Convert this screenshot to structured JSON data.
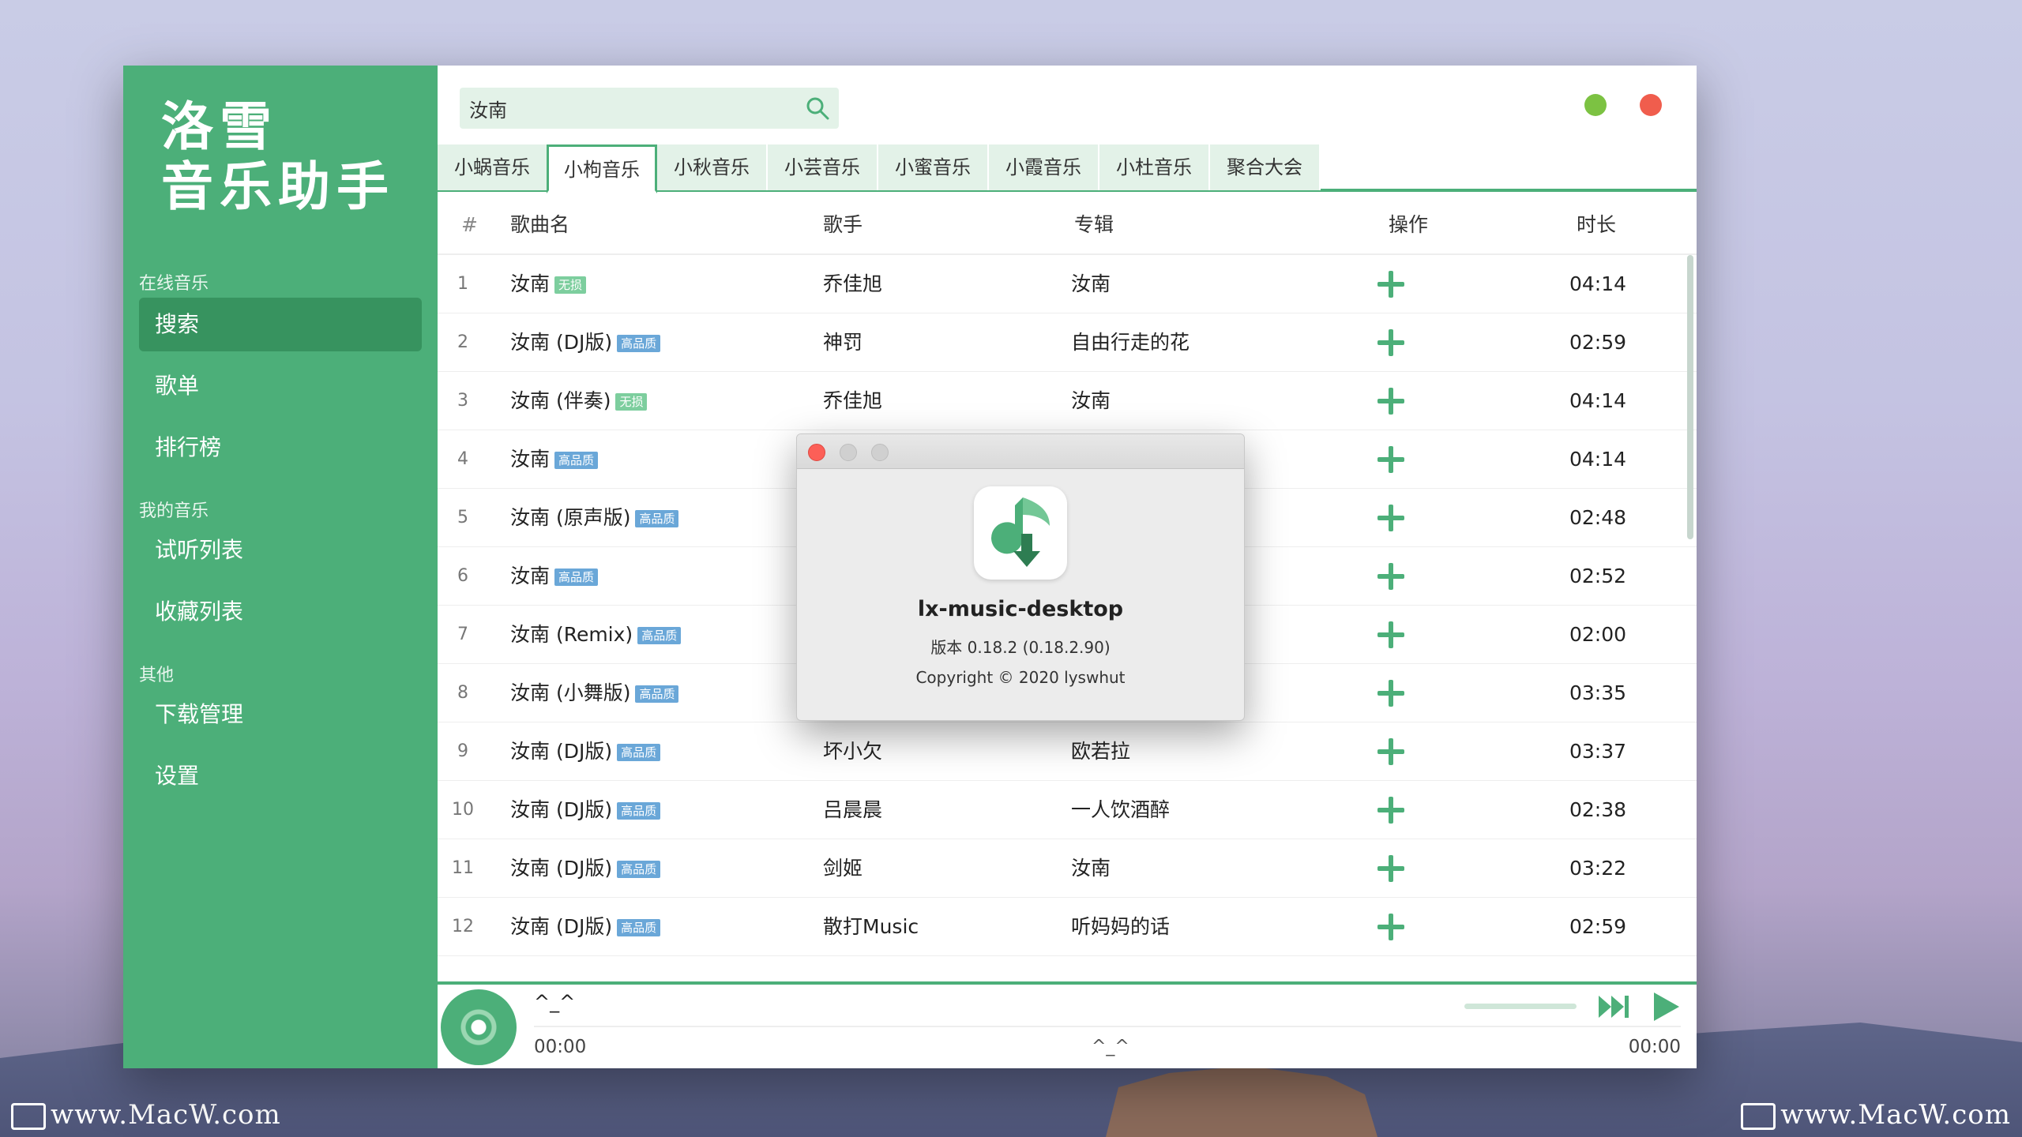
{
  "watermarks": [
    "www.MacW.com",
    "www.MacW.com"
  ],
  "sidebar": {
    "logo_line1": "洛雪",
    "logo_line2": "音乐助手",
    "groups": [
      "在线音乐",
      "我的音乐",
      "其他"
    ],
    "items": [
      "搜索",
      "歌单",
      "排行榜",
      "试听列表",
      "收藏列表",
      "下载管理",
      "设置"
    ]
  },
  "search": {
    "value": "汝南",
    "placeholder": ""
  },
  "tabs": [
    "小蜗音乐",
    "小枸音乐",
    "小秋音乐",
    "小芸音乐",
    "小蜜音乐",
    "小霞音乐",
    "小杜音乐",
    "聚合大会"
  ],
  "table": {
    "headers": [
      "#",
      "歌曲名",
      "歌手",
      "专辑",
      "操作",
      "时长"
    ],
    "rows": [
      {
        "n": "1",
        "title": "汝南",
        "badge": "无损",
        "singer": "乔佳旭",
        "album": "汝南",
        "time": "04:14"
      },
      {
        "n": "2",
        "title": "汝南 (DJ版)",
        "badge": "高品质",
        "singer": "神罚",
        "album": "自由行走的花",
        "time": "02:59"
      },
      {
        "n": "3",
        "title": "汝南 (伴奏)",
        "badge": "无损",
        "singer": "乔佳旭",
        "album": "汝南",
        "time": "04:14"
      },
      {
        "n": "4",
        "title": "汝南",
        "badge": "高品质",
        "singer": "",
        "album": "",
        "time": "04:14"
      },
      {
        "n": "5",
        "title": "汝南 (原声版)",
        "badge": "高品质",
        "singer": "",
        "album": "",
        "time": "02:48"
      },
      {
        "n": "6",
        "title": "汝南",
        "badge": "高品质",
        "singer": "",
        "album": "",
        "time": "02:52"
      },
      {
        "n": "7",
        "title": "汝南 (Remix)",
        "badge": "高品质",
        "singer": "",
        "album": "",
        "time": "02:00"
      },
      {
        "n": "8",
        "title": "汝南 (小舞版)",
        "badge": "高品质",
        "singer": "",
        "album": "",
        "time": "03:35"
      },
      {
        "n": "9",
        "title": "汝南 (DJ版)",
        "badge": "高品质",
        "singer": "坏小欠",
        "album": "欧若拉",
        "time": "03:37"
      },
      {
        "n": "10",
        "title": "汝南 (DJ版)",
        "badge": "高品质",
        "singer": "吕晨晨",
        "album": "一人饮酒醉",
        "time": "02:38"
      },
      {
        "n": "11",
        "title": "汝南 (DJ版)",
        "badge": "高品质",
        "singer": "剑姬",
        "album": "汝南",
        "time": "03:22"
      },
      {
        "n": "12",
        "title": "汝南 (DJ版)",
        "badge": "高品质",
        "singer": "散打Music",
        "album": "听妈妈的话",
        "time": "02:59"
      }
    ]
  },
  "player": {
    "title": "^_^",
    "center": "^_^",
    "time_current": "00:00",
    "time_total": "00:00"
  },
  "dialog": {
    "app_name": "lx-music-desktop",
    "version": "版本 0.18.2 (0.18.2.90)",
    "copyright": "Copyright © 2020 lyswhut"
  },
  "colors": {
    "accent": "#4caf79",
    "accent_dark": "#37935f",
    "lossless_badge": "#7dce9e",
    "hq_badge": "#6aa7d8"
  }
}
